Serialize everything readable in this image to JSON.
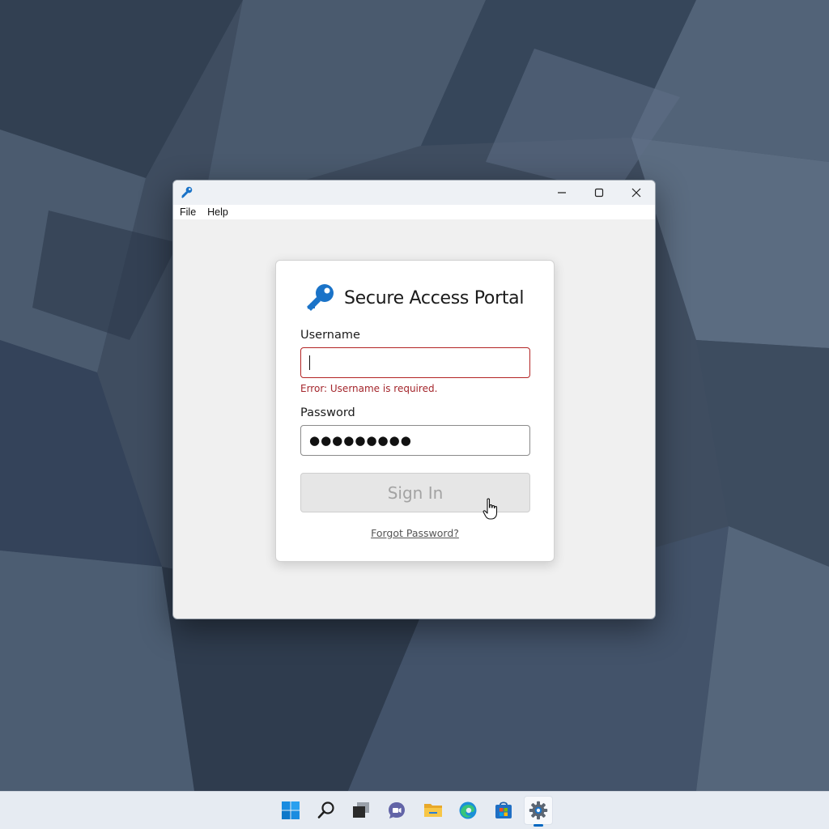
{
  "window": {
    "title": "",
    "menu": [
      "File",
      "Help"
    ]
  },
  "login": {
    "title": "Secure Access Portal",
    "username_label": "Username",
    "username_value": "",
    "username_error": "Error: Username is required.",
    "password_label": "Password",
    "password_value": "●●●●●●●●●",
    "sign_in_label": "Sign In",
    "sign_in_enabled": false,
    "forgot_password_label": "Forgot Password?"
  },
  "colors": {
    "accent": "#1a73c8",
    "error": "#a4262c",
    "disabled_button": "#e6e6e6",
    "disabled_text": "#a3a3a3"
  },
  "icons": {
    "app": "key-icon",
    "brand": "key-icon",
    "window_controls": [
      "minimize-icon",
      "maximize-icon",
      "close-icon"
    ],
    "cursor": "hand-pointer-icon"
  },
  "taskbar": {
    "items": [
      "windows-start-icon",
      "search-icon",
      "task-view-icon",
      "chat-icon",
      "file-explorer-icon",
      "edge-browser-icon",
      "store-icon",
      "settings-gear-icon"
    ],
    "active": "settings-gear-icon"
  }
}
